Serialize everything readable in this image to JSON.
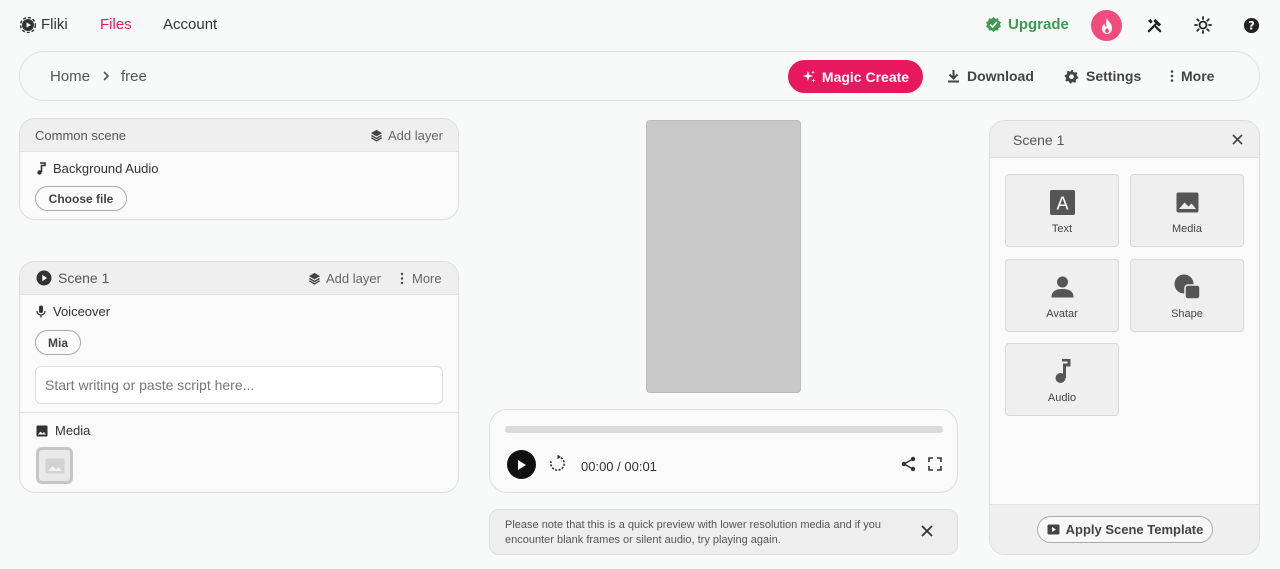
{
  "topnav": {
    "brand": "Fliki",
    "links": [
      {
        "label": "Files",
        "active": true
      },
      {
        "label": "Account",
        "active": false
      }
    ],
    "upgrade_label": "Upgrade"
  },
  "toolbar": {
    "breadcrumb": [
      {
        "label": "Home"
      },
      {
        "label": "free"
      }
    ],
    "magic_create_label": "Magic Create",
    "download_label": "Download",
    "settings_label": "Settings",
    "more_label": "More"
  },
  "common_scene": {
    "title": "Common scene",
    "add_layer_label": "Add layer",
    "background_audio_label": "Background Audio",
    "choose_file_label": "Choose file"
  },
  "scene_panel": {
    "title": "Scene 1",
    "add_layer_label": "Add layer",
    "more_label": "More",
    "voiceover_label": "Voiceover",
    "voice_name": "Mia",
    "script_placeholder": "Start writing or paste script here...",
    "script_value": "",
    "media_label": "Media"
  },
  "player": {
    "progress": 0,
    "time": "00:00 / 00:01"
  },
  "notice": {
    "text": "Please note that this is a quick preview with lower resolution media and if you encounter blank frames or silent audio, try playing again."
  },
  "layers_panel": {
    "title": "Scene 1",
    "tiles": [
      {
        "label": "Text",
        "icon": "text-icon"
      },
      {
        "label": "Media",
        "icon": "image-icon"
      },
      {
        "label": "Avatar",
        "icon": "person-icon"
      },
      {
        "label": "Shape",
        "icon": "shape-icon"
      },
      {
        "label": "Audio",
        "icon": "music-note-icon"
      }
    ],
    "apply_template_label": "Apply Scene Template"
  },
  "colors": {
    "accent": "#e8185f",
    "upgrade": "#3d9a50",
    "fire": "#f04d7d"
  }
}
